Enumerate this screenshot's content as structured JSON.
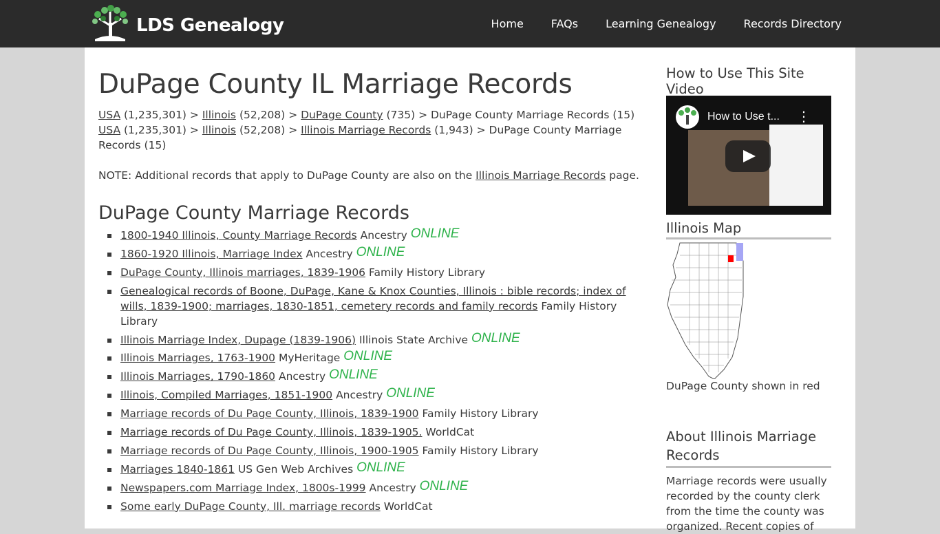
{
  "header": {
    "logo_text": "LDS Genealogy",
    "nav": [
      {
        "label": "Home"
      },
      {
        "label": "FAQs"
      },
      {
        "label": "Learning Genealogy"
      },
      {
        "label": "Records Directory"
      }
    ]
  },
  "main": {
    "title": "DuPage County IL Marriage Records",
    "breadcrumb1": {
      "usa": "USA",
      "usa_count": " (1,235,301) > ",
      "state": "Illinois",
      "state_count": " (52,208) > ",
      "county": "DuPage County",
      "county_count": " (735) > DuPage County Marriage Records (15)"
    },
    "breadcrumb2": {
      "usa": "USA",
      "usa_count": " (1,235,301) > ",
      "state": "Illinois",
      "state_count": " (52,208) > ",
      "link": "Illinois Marriage Records",
      "rest": " (1,943) > DuPage County Marriage Records (15)"
    },
    "note": {
      "prefix": "NOTE: Additional records that apply to DuPage County are also on the ",
      "link": "Illinois Marriage Records",
      "suffix": " page."
    },
    "section_title": "DuPage County Marriage Records",
    "online_label": "ONLINE",
    "records": [
      {
        "title": "1800-1940 Illinois, County Marriage Records",
        "source": " Ancestry ",
        "online": true
      },
      {
        "title": "1860-1920 Illinois, Marriage Index",
        "source": " Ancestry ",
        "online": true
      },
      {
        "title": "DuPage County, Illinois marriages, 1839-1906",
        "source": " Family History Library",
        "online": false
      },
      {
        "title": "Genealogical records of Boone, DuPage, Kane & Knox Counties, Illinois : bible records; index of wills, 1839-1900; marriages, 1830-1851, cemetery records and family records",
        "source": " Family History Library",
        "online": false
      },
      {
        "title": "Illinois Marriage Index, Dupage (1839-1906)",
        "source": " Illinois State Archive ",
        "online": true
      },
      {
        "title": "Illinois Marriages, 1763-1900",
        "source": " MyHeritage ",
        "online": true
      },
      {
        "title": "Illinois Marriages, 1790-1860",
        "source": " Ancestry ",
        "online": true
      },
      {
        "title": "Illinois, Compiled Marriages, 1851-1900",
        "source": " Ancestry ",
        "online": true
      },
      {
        "title": "Marriage records of Du Page County, Illinois, 1839-1900",
        "source": " Family History Library",
        "online": false
      },
      {
        "title": "Marriage records of Du Page County, Illinois, 1839-1905.",
        "source": " WorldCat",
        "online": false
      },
      {
        "title": "Marriage records of Du Page County, Illinois, 1900-1905",
        "source": " Family History Library",
        "online": false
      },
      {
        "title": "Marriages 1840-1861",
        "source": " US Gen Web Archives ",
        "online": true
      },
      {
        "title": "Newspapers.com Marriage Index, 1800s-1999",
        "source": " Ancestry ",
        "online": true
      },
      {
        "title": "Some early DuPage County, Ill. marriage records",
        "source": " WorldCat",
        "online": false
      }
    ]
  },
  "sidebar": {
    "video_heading": "How to Use This Site Video",
    "video_title": "How to Use t...",
    "map_heading": "Illinois Map",
    "map_caption": "DuPage County shown in red",
    "about_heading": "About Illinois Marriage Records",
    "about_text": "Marriage records were usually recorded by the county clerk from the time the county was organized. Recent copies of"
  },
  "colors": {
    "header_bg": "#2b2b2b",
    "online_green": "#2db24a",
    "highlight_county": "#ff0000",
    "lake": "#a6a6f5"
  }
}
